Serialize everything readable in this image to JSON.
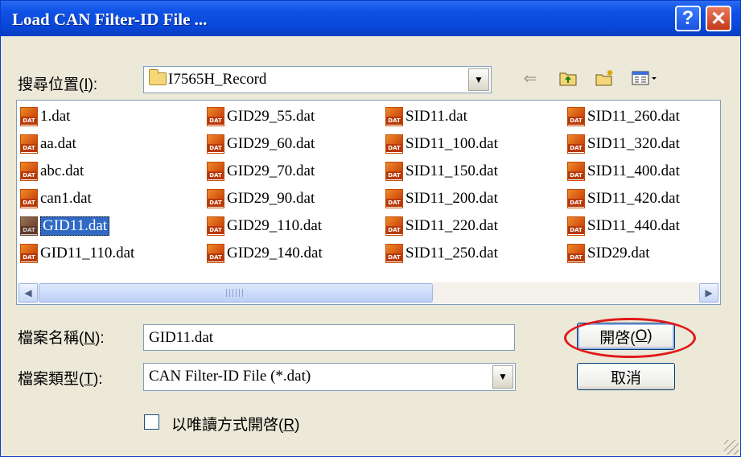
{
  "window": {
    "title": "Load CAN Filter-ID File ...",
    "help_label": "?",
    "close_label": "✕"
  },
  "look_in": {
    "label_pre": "搜尋位置(",
    "label_key": "I",
    "label_post": "):",
    "value": "I7565H_Record"
  },
  "toolbar": {
    "back_icon": "back-arrow-icon",
    "up_icon": "up-folder-icon",
    "new_folder_icon": "new-folder-icon",
    "view_menu_icon": "view-menu-icon"
  },
  "files": {
    "col1": [
      "1.dat",
      "aa.dat",
      "abc.dat",
      "can1.dat",
      "GID11.dat",
      "GID11_110.dat"
    ],
    "col2": [
      "GID29_55.dat",
      "GID29_60.dat",
      "GID29_70.dat",
      "GID29_90.dat",
      "GID29_110.dat",
      "GID29_140.dat"
    ],
    "col3": [
      "SID11.dat",
      "SID11_100.dat",
      "SID11_150.dat",
      "SID11_200.dat",
      "SID11_220.dat",
      "SID11_250.dat"
    ],
    "col4": [
      "SID11_260.dat",
      "SID11_320.dat",
      "SID11_400.dat",
      "SID11_420.dat",
      "SID11_440.dat",
      "SID29.dat"
    ],
    "selected": "GID11.dat"
  },
  "filename": {
    "label_pre": "檔案名稱(",
    "label_key": "N",
    "label_post": "):",
    "value": "GID11.dat"
  },
  "filetype": {
    "label_pre": "檔案類型(",
    "label_key": "T",
    "label_post": "):",
    "value": "CAN Filter-ID File (*.dat)"
  },
  "buttons": {
    "open_pre": "開啓(",
    "open_key": "O",
    "open_post": ")",
    "cancel": "取消"
  },
  "readonly": {
    "label_pre": "以唯讀方式開啓(",
    "label_key": "R",
    "label_post": ")",
    "checked": false
  },
  "colors": {
    "titlebar": "#0846d6",
    "highlight_ellipse": "#e01818",
    "selection": "#316ac5"
  }
}
